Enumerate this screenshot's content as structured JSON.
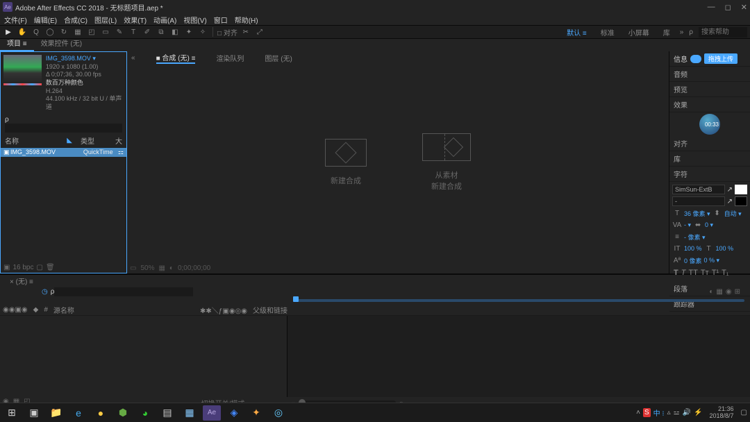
{
  "titlebar": {
    "logo_text": "Ae",
    "title": "Adobe After Effects CC 2018 - 无标题项目.aep *"
  },
  "menubar": [
    "文件(F)",
    "编辑(E)",
    "合成(C)",
    "图层(L)",
    "效果(T)",
    "动画(A)",
    "视图(V)",
    "窗口",
    "帮助(H)"
  ],
  "toolbar": {
    "snap_label": "□ 对齐",
    "workspaces": [
      "默认 ≡",
      "标准",
      "小屏幕",
      "库"
    ],
    "search_placeholder": "搜索帮助",
    "search_icon": "ρ"
  },
  "panel_tabs": {
    "project": "项目 ≡",
    "effect": "效果控件 (无)"
  },
  "project": {
    "thumb_file": "IMG_3598.MOV ▾",
    "thumb_res": "1920 x 1080 (1.00)",
    "thumb_dur": "Δ 0;07;36, 30.00 fps",
    "thumb_sub": "数百万种颜色",
    "thumb_codec": "H.264",
    "thumb_audio": "44.100 kHz / 32 bit U / 单声道",
    "search_icon": "ρ",
    "col_name": "名称",
    "col_type": "类型",
    "col_size": "大",
    "row_file": "IMG_3598.MOV",
    "row_type": "QuickTime",
    "bottom_bpc": "16 bpc"
  },
  "comp_tabs": {
    "comp": "■ 合成 (无) ≡",
    "render": "渲染队列",
    "layer": "图层 (无)"
  },
  "comp": {
    "new_comp": "新建合成",
    "from_footage": "从素材\n新建合成"
  },
  "right": {
    "header_info": "信息",
    "header_btn": "拖拽上传",
    "sections": [
      "音频",
      "预览",
      "效果",
      "对齐",
      "库",
      "字符",
      "段落",
      "跟踪器"
    ],
    "wave_time": "00:33",
    "font": "SimSun-ExtB",
    "char_size_label": "像素 ▾",
    "char_auto": "自动 ▾",
    "char_size": "36",
    "char_vscale": "100 %",
    "char_hscale": "100 %",
    "char_track": "0 像素",
    "char_baseline": "% ▾"
  },
  "timeline": {
    "tab": "× (无) ≡",
    "search_icon": "ρ",
    "layer_name_col": "源名称",
    "parent_col": "父级和链接",
    "switches": "切换开关/模式"
  },
  "taskbar": {
    "time": "21:36",
    "date": "2018/8/7"
  }
}
